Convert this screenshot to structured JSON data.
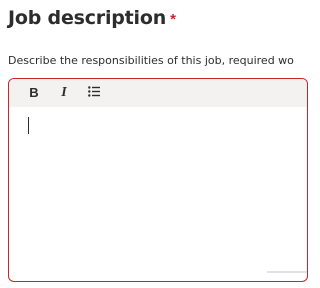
{
  "field": {
    "title": "Job description",
    "required_marker": "*",
    "description": "Describe the responsibilities of this job, required wo"
  },
  "toolbar": {
    "bold_label": "B",
    "italic_label": "I",
    "list_icon": "bulleted-list-icon"
  },
  "editor": {
    "value": ""
  },
  "colors": {
    "error_border": "#c9252d",
    "required_marker": "#c9252d",
    "toolbar_bg": "#f3f2f1",
    "text": "#2d2d2d"
  }
}
